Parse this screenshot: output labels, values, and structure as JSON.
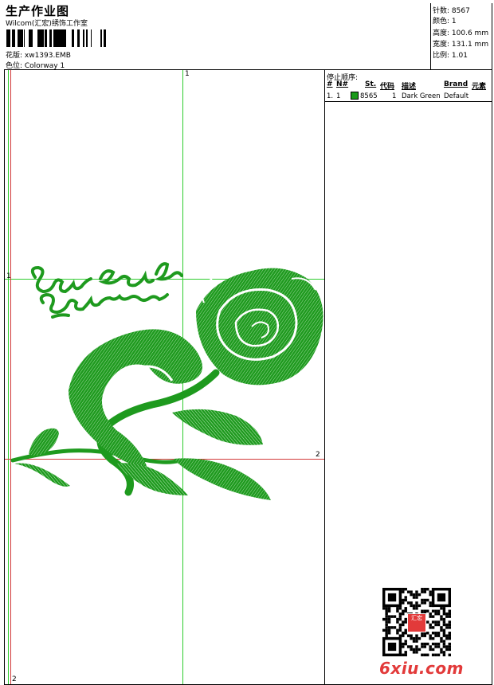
{
  "header": {
    "title": "生产作业图",
    "company": "Wilcom(汇宏)绣饰工作室",
    "design_label": "花版: xw1393.EMB",
    "colorway_label": "色位: Colorway 1"
  },
  "stats": [
    {
      "label": "针数",
      "value": "8567"
    },
    {
      "label": "颜色",
      "value": "1"
    },
    {
      "label": "高度",
      "value": "100.6 mm"
    },
    {
      "label": "宽度",
      "value": "131.1 mm"
    },
    {
      "label": "比例",
      "value": "1.01"
    }
  ],
  "stop_sequence": {
    "title": "停止顺序:",
    "columns": [
      "#",
      "N#",
      "St.",
      "代码",
      "描述",
      "Brand",
      "元素"
    ],
    "rows": [
      {
        "index": "1.",
        "needle": "1",
        "stitches": "8565",
        "code": "1",
        "description": "Dark Green",
        "brand": "Default",
        "color": "#1a9a1a"
      }
    ]
  },
  "guides": {
    "v1": "1",
    "h1": "1",
    "h2": "2",
    "bottom": "2"
  },
  "colors": {
    "thread": "#1e9a1e",
    "guide_green": "#2ecc2e",
    "guide_red": "#d23a3a"
  },
  "watermark": "6xiu.com",
  "qr": {
    "seal_text": "汇宏"
  }
}
